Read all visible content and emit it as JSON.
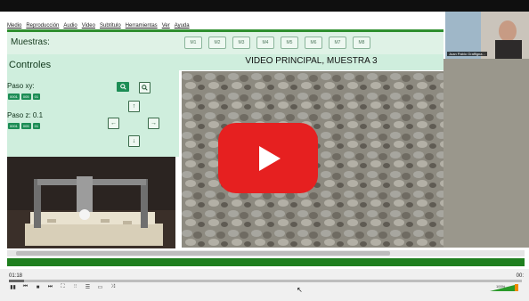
{
  "menu": {
    "items": [
      "Medio",
      "Reproducción",
      "Audio",
      "Video",
      "Subtítulo",
      "Herramientas",
      "Ver",
      "Ayuda"
    ]
  },
  "toolbar": {
    "muestras_label": "Muestras:",
    "buttons": [
      "M1",
      "M2",
      "M3",
      "M4",
      "M5",
      "M6",
      "M7",
      "M8"
    ]
  },
  "controls_panel": {
    "title": "Controles",
    "paso_xy": "Paso xy:",
    "paso_z": "Paso z: 0.1",
    "step_buttons_xy": [
      "0001",
      "005",
      "01"
    ],
    "step_buttons_z": [
      "0001",
      "005",
      "01"
    ],
    "search_icons": [
      "search-icon",
      "search-icon"
    ],
    "arrows": {
      "up": "↑",
      "left": "←",
      "right": "→",
      "down": "↓"
    }
  },
  "video": {
    "title": "VIDEO PRINCIPAL, MUESTRA 3",
    "play_icon": "play-icon"
  },
  "webcam": {
    "name": "Juan Pablo Graffigna..."
  },
  "player": {
    "time_elapsed": "01:18",
    "time_total": "00:",
    "progress": 0.03,
    "volume_percent": "100%",
    "controls": [
      "▮▮",
      "⏮",
      "■",
      "⏭",
      "⛶",
      "⫶⫶",
      "☰",
      "▭",
      "⤨"
    ]
  },
  "colors": {
    "panel_green": "#cfeedd",
    "accent_green": "#1c8d55",
    "play_red": "#e62020"
  }
}
